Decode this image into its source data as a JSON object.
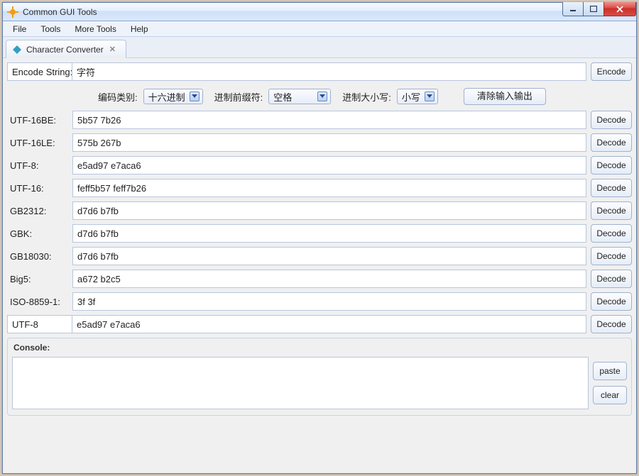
{
  "window": {
    "title": "Common GUI Tools"
  },
  "menu": {
    "file": "File",
    "tools": "Tools",
    "more_tools": "More Tools",
    "help": "Help"
  },
  "tab": {
    "label": "Character Converter"
  },
  "encode": {
    "label": "Encode String:",
    "value": "字符",
    "button": "Encode"
  },
  "options": {
    "type_label": "编码类别:",
    "type_value": "十六进制",
    "prefix_label": "进制前缀符:",
    "prefix_value": "空格",
    "case_label": "进制大小写:",
    "case_value": "小写",
    "clear_button": "清除输入输出"
  },
  "encodings": [
    {
      "label": "UTF-16BE:",
      "value": "5b57 7b26"
    },
    {
      "label": "UTF-16LE:",
      "value": "575b 267b"
    },
    {
      "label": "UTF-8:",
      "value": "e5ad97 e7aca6"
    },
    {
      "label": "UTF-16:",
      "value": "feff5b57 feff7b26"
    },
    {
      "label": "GB2312:",
      "value": "d7d6 b7fb"
    },
    {
      "label": "GBK:",
      "value": "d7d6 b7fb"
    },
    {
      "label": "GB18030:",
      "value": "d7d6 b7fb"
    },
    {
      "label": "Big5:",
      "value": "a672 b2c5"
    },
    {
      "label": "ISO-8859-1:",
      "value": "3f 3f"
    }
  ],
  "extra_row": {
    "label": "UTF-8",
    "value": "e5ad97 e7aca6"
  },
  "decode_button": "Decode",
  "console": {
    "label": "Console:",
    "paste": "paste",
    "clear": "clear"
  }
}
